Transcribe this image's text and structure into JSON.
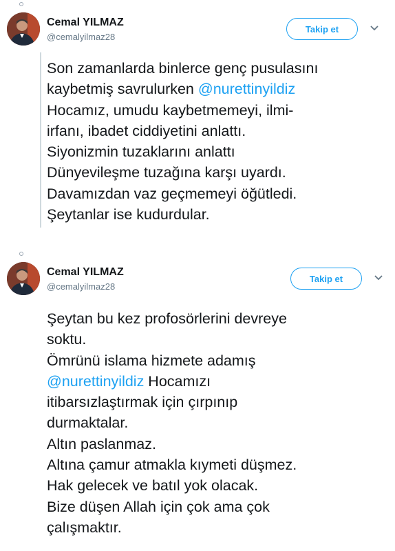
{
  "tweets": [
    {
      "author": {
        "name": "Cemal YILMAZ",
        "handle": "@cemalyilmaz28"
      },
      "follow_label": "Takip et",
      "lines": [
        "Son zamanlarda binlerce genç pusulasını",
        {
          "pre": "kaybetmiş savrulurken ",
          "mention": "@nurettinyildiz",
          "post": ""
        },
        "Hocamız, umudu kaybetmemeyi, ilmi-",
        "irfanı, ibadet ciddiyetini anlattı.",
        "Siyonizmin tuzaklarını anlattı",
        "Dünyevileşme tuzağına karşı uyardı.",
        "Davamızdan vaz geçmemeyi öğütledi.",
        "Şeytanlar ise  kudurdular."
      ]
    },
    {
      "author": {
        "name": "Cemal YILMAZ",
        "handle": "@cemalyilmaz28"
      },
      "follow_label": "Takip et",
      "lines": [
        "Şeytan bu kez profosörlerini devreye",
        "soktu.",
        "Ömrünü islama hizmete adamış",
        {
          "pre": "",
          "mention": "@nurettinyildiz",
          "post": " Hocamızı"
        },
        "itibarsızlaştırmak için çırpınıp",
        "durmaktalar.",
        "Altın paslanmaz.",
        "Altına çamur atmakla kıymeti düşmez.",
        "Hak gelecek ve batıl yok olacak.",
        "Bize düşen  Allah için çok ama çok",
        "çalışmaktır."
      ]
    }
  ],
  "icons": {
    "avatar": "profile-photo",
    "menu": "chevron-down-icon"
  },
  "colors": {
    "accent": "#1da1f2",
    "text": "#14171a",
    "muted": "#657786",
    "thread": "#cfd9de"
  }
}
